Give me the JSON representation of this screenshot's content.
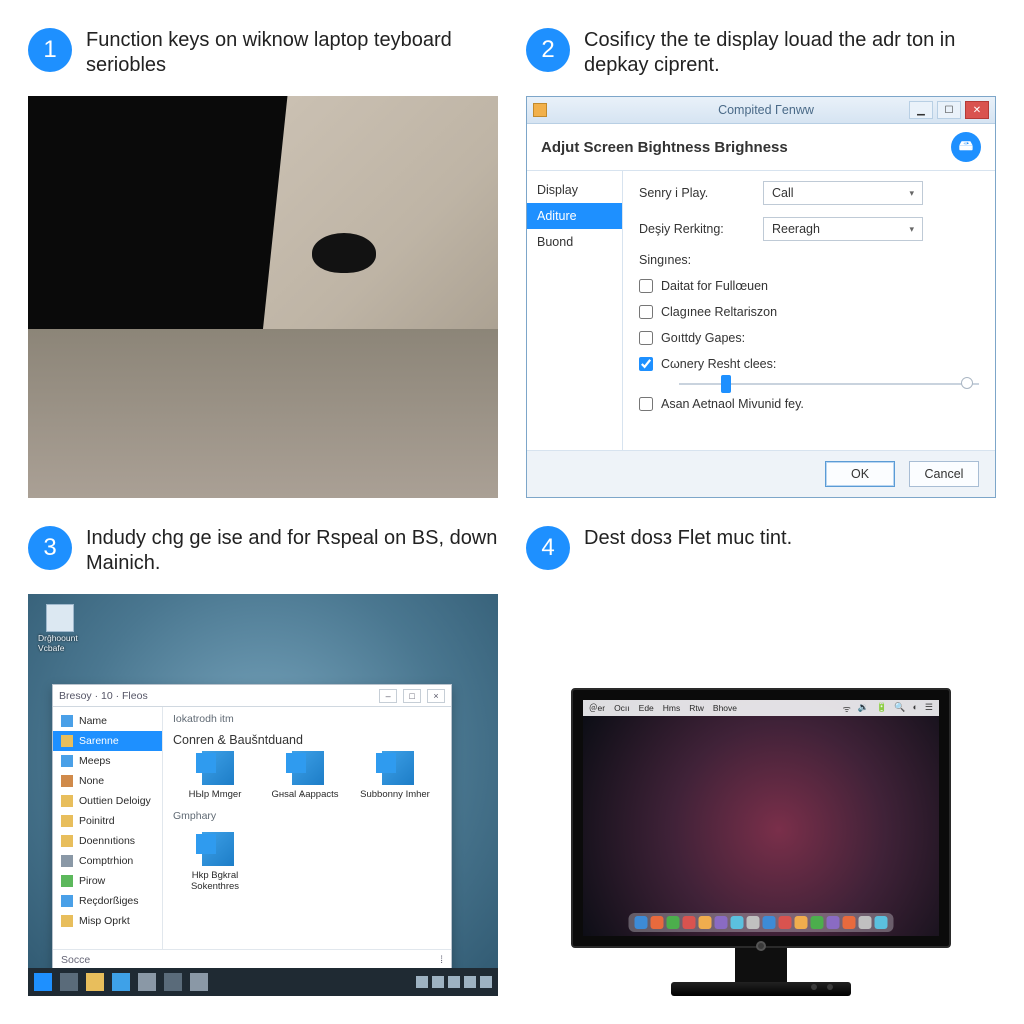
{
  "step1": {
    "number": "1",
    "text": "Function keys on wiknow laptop teyboard seriobles"
  },
  "step2": {
    "number": "2",
    "text": "Cosifıcy the te display louad the adr ton in depkaу ciprent.",
    "window": {
      "title": "Compited Γenww",
      "header": "Adjut Screen Bightness Brighness",
      "sidebar": {
        "items": [
          "Display",
          "Aditure",
          "Buond"
        ],
        "selected": 1
      },
      "field1_label": "Senry i Play.",
      "field1_value": "Call",
      "field2_label": "Deşiy Rerkitng:",
      "field2_value": "Reeragh",
      "section": "Singınes:",
      "chk1": "Daitat for Fullœuen",
      "chk2": "Clagınее Reltariszon",
      "chk3": "Goıttdy Gapes:",
      "chk4": "Cωnery Resht clees:",
      "chk5": "Asan Aetnaol Mivunid fey.",
      "ok": "OK",
      "cancel": "Cancel"
    }
  },
  "step3": {
    "number": "3",
    "text": "Indudy chg ge ise and for Rspeal on BS, down Mainich.",
    "desktop_icon": "Drğhoount Vcbafe",
    "explorer": {
      "title": "Bresoy · 10 · Fleos",
      "side": [
        "Name",
        "Sarenne",
        "Meeps",
        "None",
        "Outtien Deloigy",
        "Poinitrd",
        "Doennıtions",
        "Comptrhion",
        "Pirow",
        "Reçdorßiges",
        "Misp Oprkt"
      ],
      "side_selected": 1,
      "heading": "Iokatrodh itm",
      "row1_label": "Conren & Baušntduand",
      "items1": [
        "HЫр Mmger",
        "Gнsal Ѧapраcts",
        "Subbonny Imher"
      ],
      "row2_label": "Gmphary",
      "items2": [
        "Hkp Bgkral Sokenthres"
      ],
      "status": "Socce"
    }
  },
  "step4": {
    "number": "4",
    "text": "Dest dosз Flet muc tint.",
    "mac_menu": [
      "＠er",
      "Ocıı",
      "Ede",
      "Hms",
      "Rtw",
      "Bhove"
    ]
  }
}
